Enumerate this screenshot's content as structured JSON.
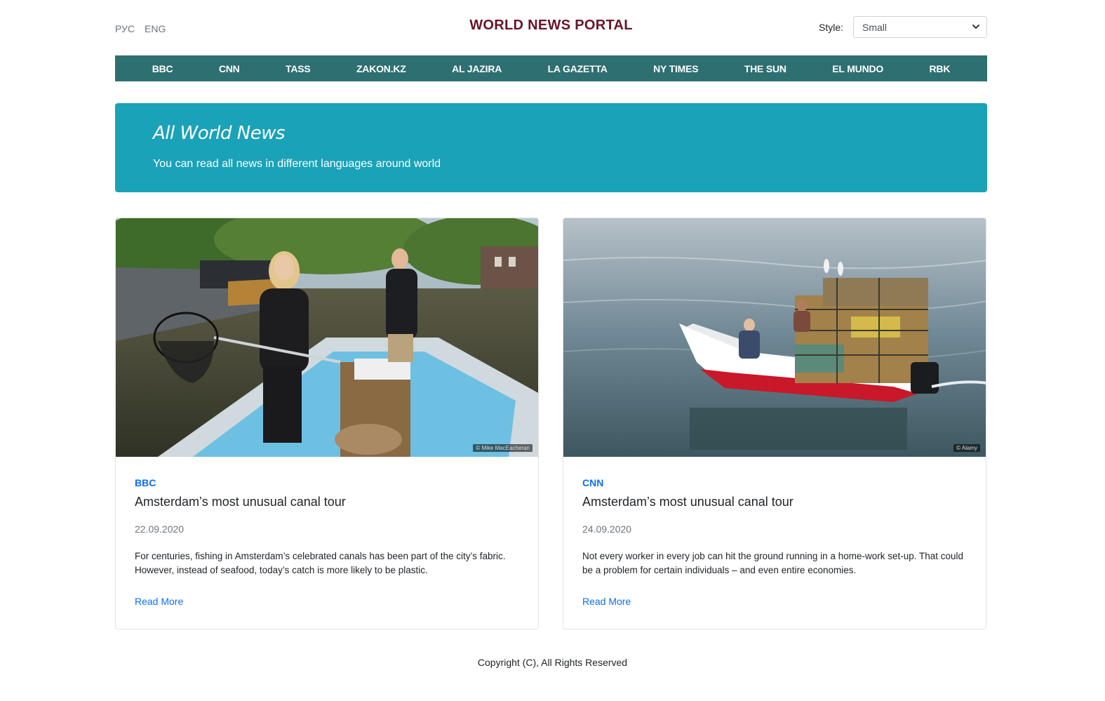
{
  "header": {
    "languages": [
      "РУС",
      "ENG"
    ],
    "brand": "WORLD NEWS PORTAL",
    "style_label": "Style:",
    "style_value": "Small"
  },
  "nav": {
    "items": [
      "BBC",
      "CNN",
      "TASS",
      "ZAKON.KZ",
      "AL JAZIRA",
      "LA GAZETTA",
      "NY TIMES",
      "THE SUN",
      "EL MUNDO",
      "RBK"
    ]
  },
  "jumbotron": {
    "title": "All World News",
    "subtitle": "You can read all news in different languages around world"
  },
  "cards": [
    {
      "source": "BBC",
      "title": "Amsterdam’s most unusual canal tour",
      "date": "22.09.2020",
      "text": "For centuries, fishing in Amsterdam’s celebrated canals has been part of the city’s fabric. However, instead of seafood, today’s catch is more likely to be plastic.",
      "link": "Read More",
      "credit": "© Mike MacEacheran"
    },
    {
      "source": "CNN",
      "title": "Amsterdam’s most unusual canal tour",
      "date": "24.09.2020",
      "text": "Not every worker in every job can hit the ground running in a home-work set-up. That could be a problem for certain individuals – and even entire economies.",
      "link": "Read More",
      "credit": "© Alamy"
    }
  ],
  "footer": {
    "copyright": "Copyright (C), All Rights Reserved"
  },
  "colors": {
    "brand": "#6b1428",
    "navbar": "#2e6f71",
    "jumbotron": "#1aa2b8",
    "link": "#0d6efd"
  }
}
